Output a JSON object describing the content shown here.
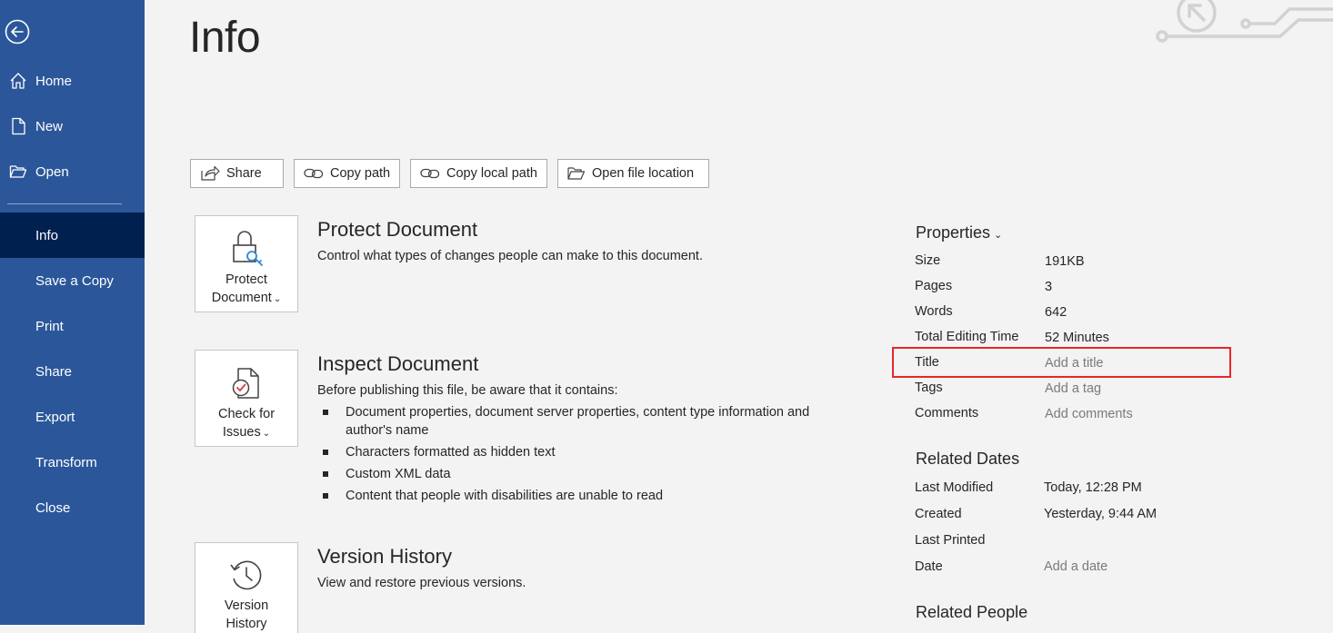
{
  "page": {
    "title": "Info"
  },
  "sidebar": {
    "items": [
      {
        "label": "Home",
        "icon": "home-icon"
      },
      {
        "label": "New",
        "icon": "new-document-icon"
      },
      {
        "label": "Open",
        "icon": "open-folder-icon"
      },
      {
        "label": "Info"
      },
      {
        "label": "Save a Copy"
      },
      {
        "label": "Print"
      },
      {
        "label": "Share"
      },
      {
        "label": "Export"
      },
      {
        "label": "Transform"
      },
      {
        "label": "Close"
      }
    ],
    "active": "Info",
    "back_icon": "back-arrow-icon",
    "background": "#2b579a",
    "active_background": "#002050"
  },
  "toolbar": {
    "share": "Share",
    "copy_path": "Copy path",
    "copy_local_path": "Copy local path",
    "open_file_location": "Open file location"
  },
  "sections": {
    "protect": {
      "tile_line1": "Protect",
      "tile_line2": "Document",
      "title": "Protect Document",
      "desc": "Control what types of changes people can make to this document."
    },
    "inspect": {
      "tile_line1": "Check for",
      "tile_line2": "Issues",
      "title": "Inspect Document",
      "desc": "Before publishing this file, be aware that it contains:",
      "bullets": [
        "Document properties, document server properties, content type information and author's name",
        "Characters formatted as hidden text",
        "Custom XML data",
        "Content that people with disabilities are unable to read"
      ]
    },
    "version": {
      "tile_line1": "Version",
      "tile_line2": "History",
      "title": "Version History",
      "desc": "View and restore previous versions."
    }
  },
  "properties": {
    "heading": "Properties",
    "rows": [
      {
        "label": "Size",
        "value": "191KB"
      },
      {
        "label": "Pages",
        "value": "3"
      },
      {
        "label": "Words",
        "value": "642"
      },
      {
        "label": "Total Editing Time",
        "value": "52 Minutes"
      },
      {
        "label": "Title",
        "value": "Add a title"
      },
      {
        "label": "Tags",
        "value": "Add a tag"
      },
      {
        "label": "Comments",
        "value": "Add comments"
      }
    ]
  },
  "related_dates": {
    "heading": "Related Dates",
    "rows": [
      {
        "label": "Last Modified",
        "value": "Today, 12:28 PM"
      },
      {
        "label": "Created",
        "value": "Yesterday, 9:44 AM"
      },
      {
        "label": "Last Printed",
        "value": ""
      },
      {
        "label": "Date",
        "value": "Add a date"
      }
    ]
  },
  "related_people": {
    "heading": "Related People"
  },
  "colors": {
    "highlight": "#e8262b",
    "placeholder": "#7a7a7a"
  }
}
